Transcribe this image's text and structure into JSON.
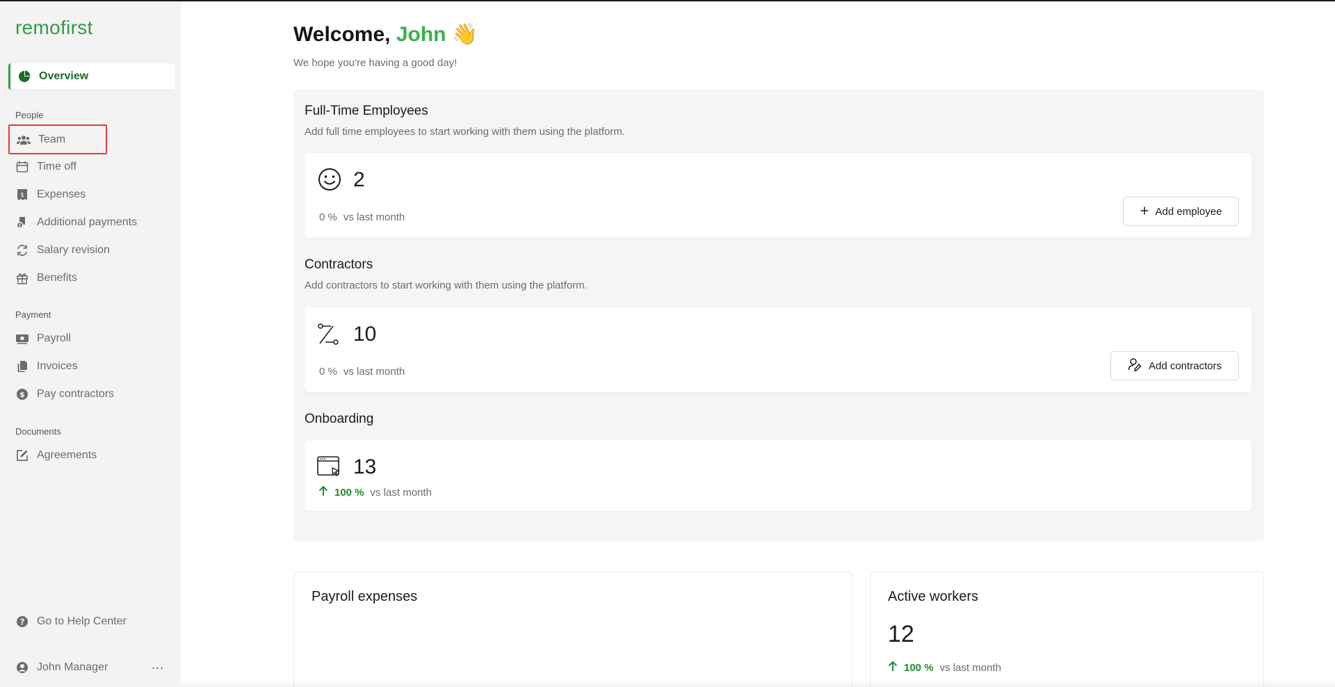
{
  "brand": {
    "logo_text": "remofirst",
    "accent_color": "#2f9e44"
  },
  "sidebar": {
    "overview": {
      "label": "Overview",
      "icon": "pie-chart-icon"
    },
    "sections": {
      "people": "People",
      "payment": "Payment",
      "documents": "Documents"
    },
    "people_items": [
      {
        "label": "Team",
        "icon": "users-icon"
      },
      {
        "label": "Time off",
        "icon": "calendar-icon"
      },
      {
        "label": "Expenses",
        "icon": "receipt-icon"
      },
      {
        "label": "Additional payments",
        "icon": "coins-icon"
      },
      {
        "label": "Salary revision",
        "icon": "refresh-icon"
      },
      {
        "label": "Benefits",
        "icon": "gift-icon"
      }
    ],
    "payment_items": [
      {
        "label": "Payroll",
        "icon": "money-icon"
      },
      {
        "label": "Invoices",
        "icon": "documents-icon"
      },
      {
        "label": "Pay contractors",
        "icon": "dollar-icon"
      }
    ],
    "documents_items": [
      {
        "label": "Agreements",
        "icon": "edit-icon"
      }
    ],
    "help": {
      "label": "Go to Help Center",
      "icon": "question-icon"
    },
    "user": {
      "label": "John Manager",
      "icon": "user-circle-icon",
      "menu": "..."
    }
  },
  "header": {
    "welcome_prefix": "Welcome,",
    "welcome_name": "John",
    "wave_emoji": "👋",
    "subtitle": "We hope you're having a good day!"
  },
  "fulltime": {
    "title": "Full-Time Employees",
    "desc": "Add full time employees to start working with them using the platform.",
    "icon": "smiley-icon",
    "count": "2",
    "pct": "0 %",
    "vs": "vs last month",
    "button": "Add employee"
  },
  "contractors": {
    "title": "Contractors",
    "desc": "Add contractors to start working with them using the platform.",
    "icon": "percent-icon",
    "count": "10",
    "pct": "0 %",
    "vs": "vs last month",
    "button": "Add contractors"
  },
  "onboarding": {
    "title": "Onboarding",
    "icon": "browser-cursor-icon",
    "count": "13",
    "pct": "100 %",
    "vs": "vs last month"
  },
  "payroll_expenses": {
    "title": "Payroll expenses"
  },
  "active_workers": {
    "title": "Active workers",
    "count": "12",
    "pct": "100 %",
    "vs": "vs last month"
  }
}
